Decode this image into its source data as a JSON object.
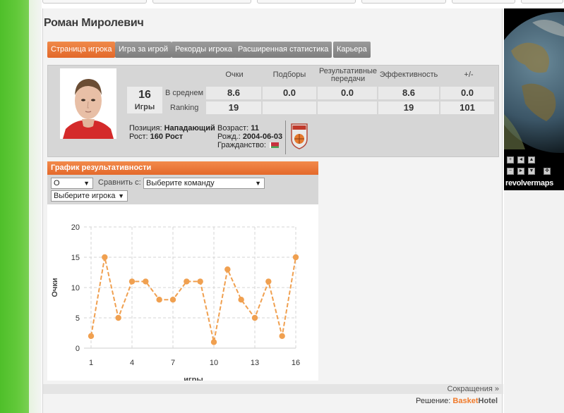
{
  "player": {
    "name": "Роман Миролевич",
    "position_label": "Позиция:",
    "position": "Нападающий",
    "height_label": "Рост:",
    "height": "160 Рост",
    "age_label": "Возраст:",
    "age": "11",
    "born_label": "Рожд.:",
    "born": "2004-06-03",
    "citizenship_label": "Гражданство:"
  },
  "tabs": [
    {
      "label": "Страница игрока",
      "active": true
    },
    {
      "label": "Игра за игрой",
      "active": false
    },
    {
      "label": "Рекорды игрока",
      "active": false
    },
    {
      "label": "Расширенная статистика",
      "active": false
    },
    {
      "label": "Карьера",
      "active": false
    }
  ],
  "stats": {
    "games_count": "16",
    "games_label": "Игры",
    "columns": [
      "Очки",
      "Подборы",
      "Результативные передачи",
      "Эффективность",
      "+/-"
    ],
    "avg_label": "В среднем",
    "ranking_label": "Ranking",
    "avg": [
      "8.6",
      "0.0",
      "0.0",
      "8.6",
      "0.0"
    ],
    "ranking": [
      "19",
      "",
      "",
      "19",
      "101"
    ]
  },
  "chart_panel": {
    "title": "График результативности",
    "metric_select": "О",
    "compare_label": "Сравнить с:",
    "team_select": "Выберите команду",
    "player_select": "Выберите игрока"
  },
  "chart_data": {
    "type": "line",
    "x": [
      1,
      2,
      3,
      4,
      5,
      6,
      7,
      8,
      9,
      10,
      11,
      12,
      13,
      14,
      15,
      16
    ],
    "series": [
      {
        "values": [
          2,
          15,
          5,
          11,
          11,
          8,
          8,
          11,
          11,
          1,
          13,
          8,
          5,
          11,
          2,
          15
        ]
      }
    ],
    "xlabel": "игры",
    "ylabel": "Очки",
    "xticks": [
      1,
      4,
      7,
      10,
      13,
      16
    ],
    "yticks": [
      0,
      5,
      10,
      15,
      20
    ],
    "ylim": [
      0,
      20
    ],
    "xlim": [
      1,
      16
    ],
    "grid": true,
    "color": "#f0a050"
  },
  "footer": {
    "abbrev_link": "Сокращения »",
    "solution_label": "Решение:",
    "brand_a": "Basket",
    "brand_b": "Hotel"
  },
  "widget": {
    "brand": "revolvermaps",
    "controls": [
      "+",
      "◄",
      "▲",
      "−",
      "►",
      "▼",
      "✥"
    ]
  }
}
